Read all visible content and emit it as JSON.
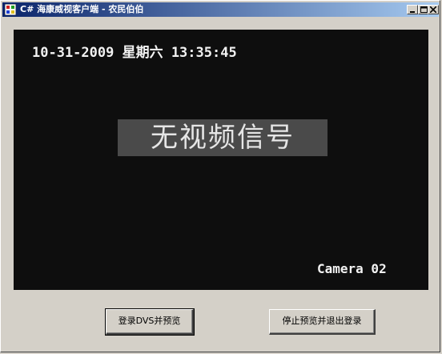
{
  "window": {
    "title": "C# 海康威视客户端 - 农民伯伯",
    "minimize_label": "_",
    "maximize_label": "□",
    "close_label": "×"
  },
  "video": {
    "osd_datetime": "10-31-2009 星期六 13:35:45",
    "no_signal": "无视频信号",
    "camera_label": "Camera 02"
  },
  "buttons": {
    "login_preview": "登录DVS并预览",
    "stop_logout": "停止预览并退出登录"
  },
  "colors": {
    "titlebar_start": "#0a246a",
    "titlebar_end": "#a6caf0",
    "window_bg": "#d4d0c8",
    "video_bg": "#0e0e0e",
    "osd_text": "#f2f2f2",
    "no_signal_bg": "#4a4a4a"
  }
}
